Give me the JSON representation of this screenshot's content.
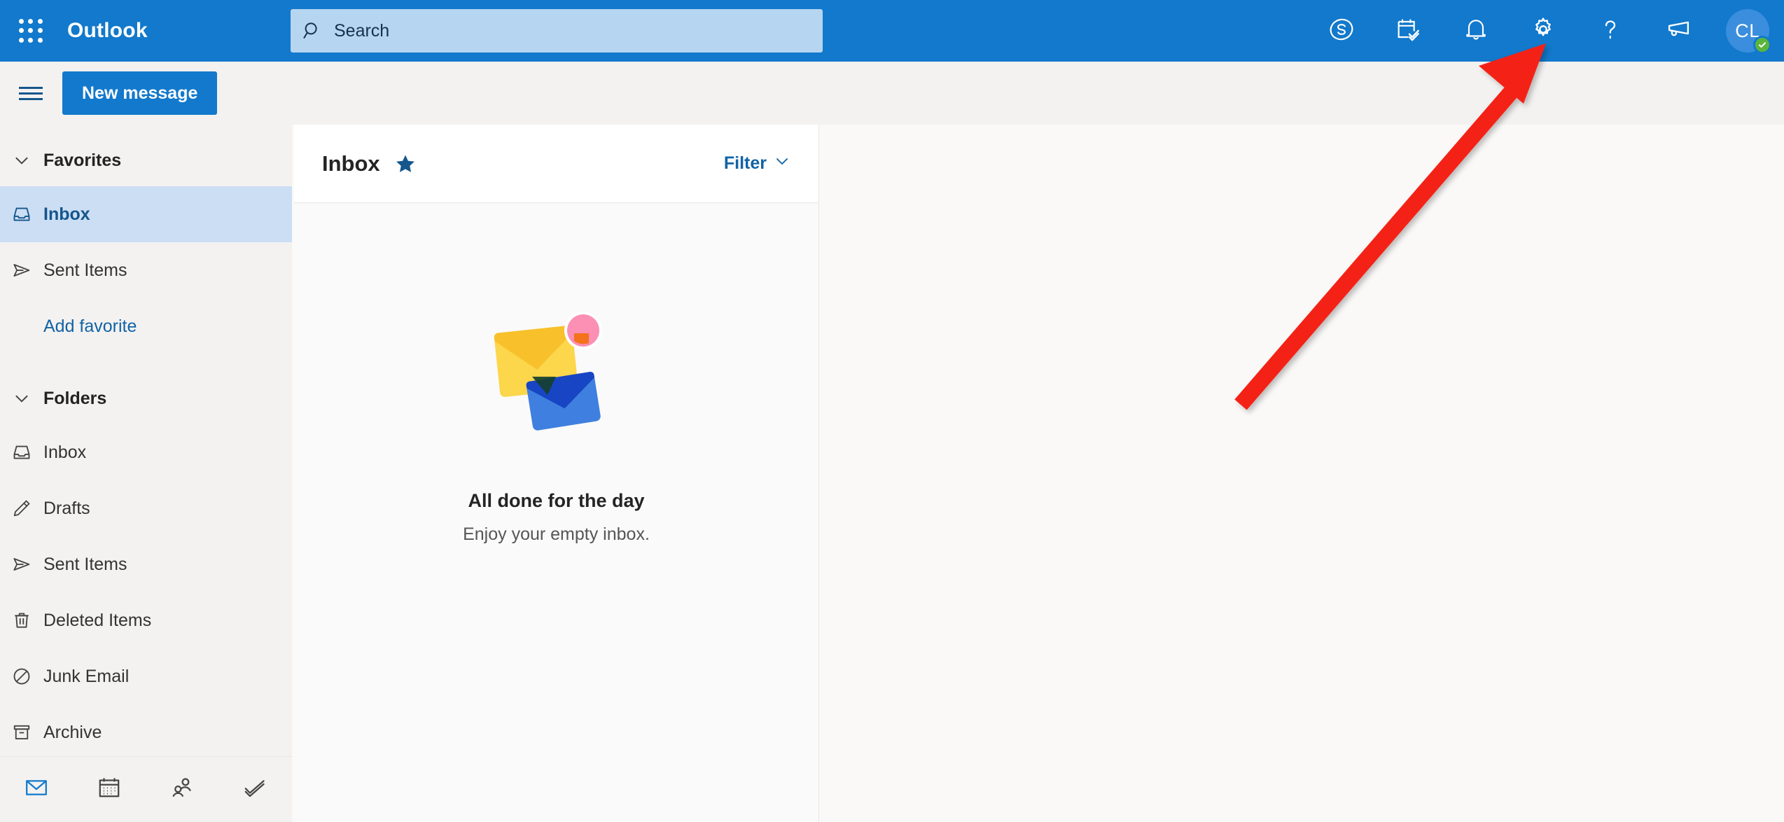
{
  "app": {
    "brand": "Outlook",
    "accent_color": "#1279cc",
    "search_field_color": "#b5d5f0",
    "selected_item_color": "#cbdef4",
    "annotation_color": "#f42314"
  },
  "topbar": {
    "waffle_label": "App launcher",
    "search": {
      "placeholder": "Search",
      "value": ""
    },
    "actions": [
      {
        "name": "skype-icon",
        "label": "Skype"
      },
      {
        "name": "todo-icon",
        "label": "To Do"
      },
      {
        "name": "bell-icon",
        "label": "Notifications"
      },
      {
        "name": "gear-icon",
        "label": "Settings"
      },
      {
        "name": "help-icon",
        "label": "Help"
      },
      {
        "name": "megaphone-icon",
        "label": "Feedback"
      }
    ],
    "account": {
      "initials": "CL",
      "presence": "Available"
    }
  },
  "toolbar": {
    "menu_label": "Show navigation pane",
    "new_message_label": "New message"
  },
  "sidebar": {
    "favorites": {
      "label": "Favorites",
      "expanded": true,
      "items": [
        {
          "label": "Inbox",
          "icon": "inbox-icon",
          "selected": true
        },
        {
          "label": "Sent Items",
          "icon": "send-icon",
          "selected": false
        }
      ],
      "add_favorite_label": "Add favorite"
    },
    "folders": {
      "label": "Folders",
      "expanded": true,
      "items": [
        {
          "label": "Inbox",
          "icon": "inbox-icon"
        },
        {
          "label": "Drafts",
          "icon": "pencil-icon"
        },
        {
          "label": "Sent Items",
          "icon": "send-icon"
        },
        {
          "label": "Deleted Items",
          "icon": "trash-icon"
        },
        {
          "label": "Junk Email",
          "icon": "block-icon"
        },
        {
          "label": "Archive",
          "icon": "archive-icon"
        }
      ]
    },
    "bottom_nav": [
      {
        "name": "mail-icon",
        "label": "Mail",
        "active": true
      },
      {
        "name": "calendar-icon",
        "label": "Calendar",
        "active": false
      },
      {
        "name": "people-icon",
        "label": "People",
        "active": false
      },
      {
        "name": "todo-icon",
        "label": "To Do",
        "active": false
      }
    ]
  },
  "message_list": {
    "title": "Inbox",
    "pinned_icon": "star-icon",
    "filter_label": "Filter",
    "empty_state": {
      "title": "All done for the day",
      "subtitle": "Enjoy your empty inbox."
    }
  },
  "annotation": {
    "type": "arrow",
    "points_to": "gear-icon",
    "color": "#f42314"
  }
}
